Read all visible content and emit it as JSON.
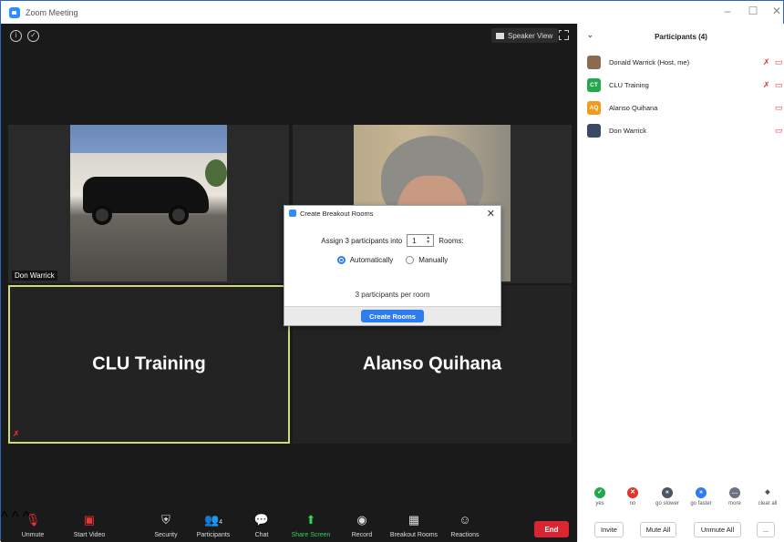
{
  "window": {
    "title": "Zoom Meeting",
    "minimize": "–",
    "maximize": "☐",
    "close": "✕"
  },
  "video": {
    "speaker_view_label": "Speaker View",
    "tiles": [
      {
        "name": "Don Warrick"
      },
      {
        "name": ""
      },
      {
        "name": "CLU Training"
      },
      {
        "name": "Alanso Quihana"
      }
    ]
  },
  "dialog": {
    "title": "Create Breakout Rooms",
    "assign_prefix": "Assign 3 participants into",
    "rooms_value": "1",
    "rooms_suffix": "Rooms:",
    "option_auto": "Automatically",
    "option_manual": "Manually",
    "selected": "Automatically",
    "per_room": "3 participants per room",
    "create_button": "Create Rooms",
    "close": "✕"
  },
  "toolbar": {
    "unmute": "Unmute",
    "start_video": "Start Video",
    "security": "Security",
    "participants": "Participants",
    "participants_count": "4",
    "chat": "Chat",
    "share_screen": "Share Screen",
    "record": "Record",
    "breakout_rooms": "Breakout Rooms",
    "reactions": "Reactions",
    "end": "End"
  },
  "panel": {
    "title": "Participants (4)",
    "participants": [
      {
        "name": "Donald Warrick (Host, me)",
        "initials": "",
        "color": "#8a6b50",
        "mic_muted": true,
        "video_off": true
      },
      {
        "name": "CLU Training",
        "initials": "CT",
        "color": "#25a74c",
        "mic_muted": true,
        "video_off": true
      },
      {
        "name": "Alanso Quihana",
        "initials": "AQ",
        "color": "#f19a1c",
        "mic_muted": false,
        "video_off": true
      },
      {
        "name": "Don Warrick",
        "initials": "",
        "color": "#3b4a63",
        "mic_muted": false,
        "video_off": true
      }
    ],
    "reactions": [
      {
        "label": "yes",
        "color": "#25a74c",
        "glyph": "✓"
      },
      {
        "label": "no",
        "color": "#e0352b",
        "glyph": "✕"
      },
      {
        "label": "go slower",
        "color": "#4b5563",
        "glyph": "«"
      },
      {
        "label": "go faster",
        "color": "#2d7df0",
        "glyph": "»"
      },
      {
        "label": "more",
        "color": "#6b7280",
        "glyph": "…"
      },
      {
        "label": "clear all",
        "color": "#ffffff",
        "glyph": "◆"
      }
    ],
    "invite": "Invite",
    "mute_all": "Mute All",
    "unmute_all": "Unmute All",
    "more": "..."
  }
}
